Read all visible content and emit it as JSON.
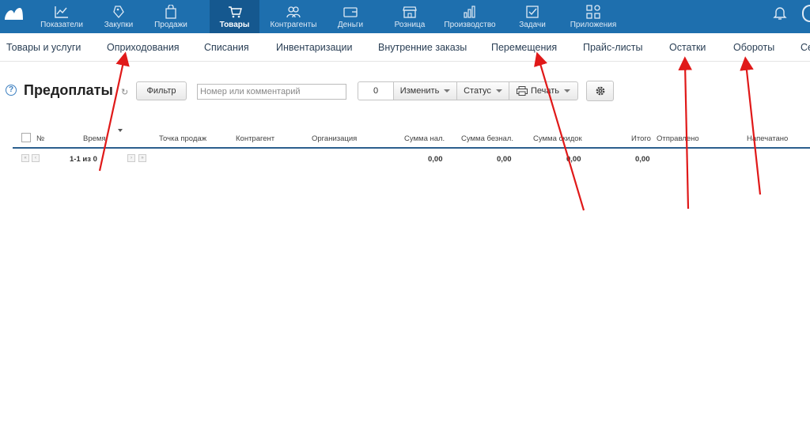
{
  "nav": {
    "items": [
      {
        "label": "Показатели",
        "icon": "chart-icon"
      },
      {
        "label": "Закупки",
        "icon": "tags-icon"
      },
      {
        "label": "Продажи",
        "icon": "bag-icon"
      },
      {
        "label": "Товары",
        "icon": "cart-icon",
        "active": true
      },
      {
        "label": "Контрагенты",
        "icon": "people-icon"
      },
      {
        "label": "Деньги",
        "icon": "wallet-icon"
      },
      {
        "label": "Розница",
        "icon": "store-icon"
      },
      {
        "label": "Производство",
        "icon": "factory-icon"
      },
      {
        "label": "Задачи",
        "icon": "checkbox-icon"
      },
      {
        "label": "Приложения",
        "icon": "apps-icon"
      }
    ],
    "colors": {
      "bar": "#1e6fae",
      "active": "#15588f"
    }
  },
  "subnav": {
    "items": [
      "Товары и услуги",
      "Оприходования",
      "Списания",
      "Инвентаризации",
      "Внутренние заказы",
      "Перемещения",
      "Прайс-листы",
      "Остатки",
      "Обороты",
      "Се"
    ]
  },
  "page": {
    "title": "Предоплаты",
    "help": "?",
    "filter_label": "Фильтр",
    "search_placeholder": "Номер или комментарий",
    "selected_count": "0",
    "change_label": "Изменить",
    "status_label": "Статус",
    "print_label": "Печать"
  },
  "table": {
    "columns": {
      "number": "№",
      "time": "Время",
      "pos": "Точка продаж",
      "counterparty": "Контрагент",
      "org": "Организация",
      "cash": "Сумма нал.",
      "noncash": "Сумма безнал.",
      "discount": "Сумма скидок",
      "total": "Итого",
      "sent": "Отправлено",
      "printed": "Напечатано"
    },
    "pagination": "1-1 из 0",
    "totals": {
      "cash": "0,00",
      "noncash": "0,00",
      "discount": "0,00",
      "total": "0,00"
    }
  },
  "annotation_color": "#e01919"
}
